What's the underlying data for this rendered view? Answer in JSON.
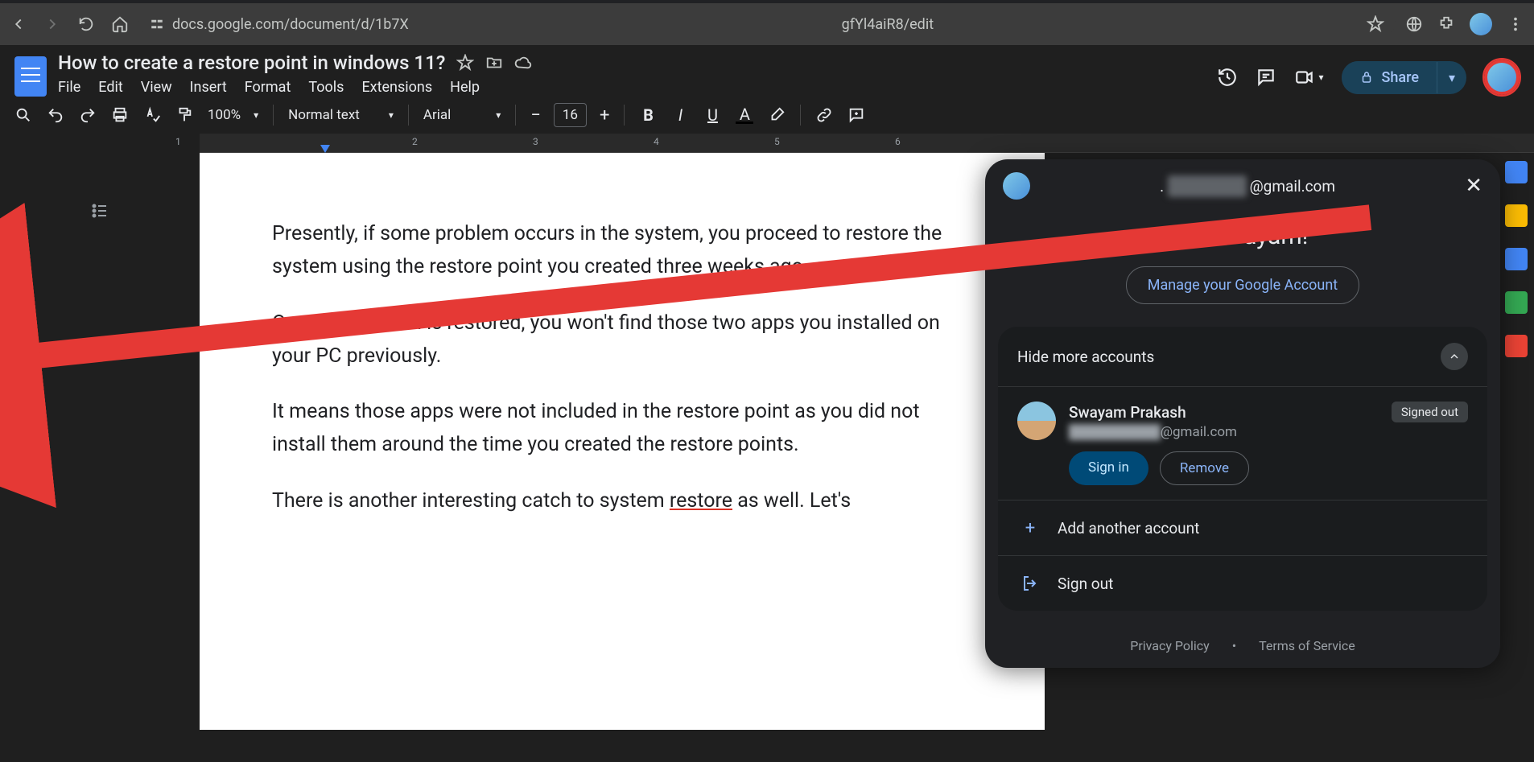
{
  "browser": {
    "url_part1": "docs.google.com/document/d/1b7X",
    "url_part2": "gfYl4aiR8/edit"
  },
  "doc": {
    "title": "How to create a restore point in windows 11?",
    "menus": [
      "File",
      "Edit",
      "View",
      "Insert",
      "Format",
      "Tools",
      "Extensions",
      "Help"
    ],
    "share": "Share"
  },
  "toolbar": {
    "zoom": "100%",
    "style": "Normal text",
    "font": "Arial",
    "size": "16"
  },
  "content": {
    "p1": "Presently, if some problem occurs in the system, you proceed to restore the system using the restore point you created three weeks ago.",
    "p2": "Once the system is restored, you won't find those two apps you installed on your PC previously.",
    "p3": "It means those apps were not included in the restore point as you did not install them around the time you created the restore points.",
    "p4a": "There is another interesting catch to system ",
    "p4u": "restore",
    "p4b": " as well. Let's"
  },
  "ruler": [
    "1",
    "2",
    "3",
    "4",
    "5",
    "6"
  ],
  "popup": {
    "email_suffix": "@gmail.com",
    "greeting": "Hi, Swayam!",
    "manage": "Manage your Google Account",
    "hide": "Hide more accounts",
    "acct_name": "Swayam Prakash",
    "signed_out": "Signed out",
    "signin": "Sign in",
    "remove": "Remove",
    "add": "Add another account",
    "signout": "Sign out",
    "privacy": "Privacy Policy",
    "terms": "Terms of Service"
  }
}
